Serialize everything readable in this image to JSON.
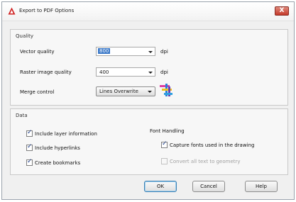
{
  "window": {
    "title": "Export to PDF Options",
    "close_label": "X"
  },
  "quality": {
    "group_title": "Quality",
    "vector_quality_label": "Vector quality",
    "vector_quality_value": "800",
    "vector_quality_unit": "dpi",
    "raster_quality_label": "Raster image quality",
    "raster_quality_value": "400",
    "raster_quality_unit": "dpi",
    "merge_control_label": "Merge control",
    "merge_control_value": "Lines Overwrite"
  },
  "data": {
    "group_title": "Data",
    "include_layer_label": "Include layer information",
    "include_layer_checked": true,
    "include_hyperlinks_label": "Include hyperlinks",
    "include_hyperlinks_checked": true,
    "create_bookmarks_label": "Create bookmarks",
    "create_bookmarks_checked": true
  },
  "font_handling": {
    "title": "Font Handling",
    "capture_fonts_label": "Capture fonts used in the drawing",
    "capture_fonts_checked": true,
    "convert_text_label": "Convert all text to geometry",
    "convert_text_checked": false
  },
  "buttons": {
    "ok": "OK",
    "cancel": "Cancel",
    "help": "Help"
  },
  "colors": {
    "accent_selection": "#3a78c8",
    "close_button": "#c4392a"
  }
}
